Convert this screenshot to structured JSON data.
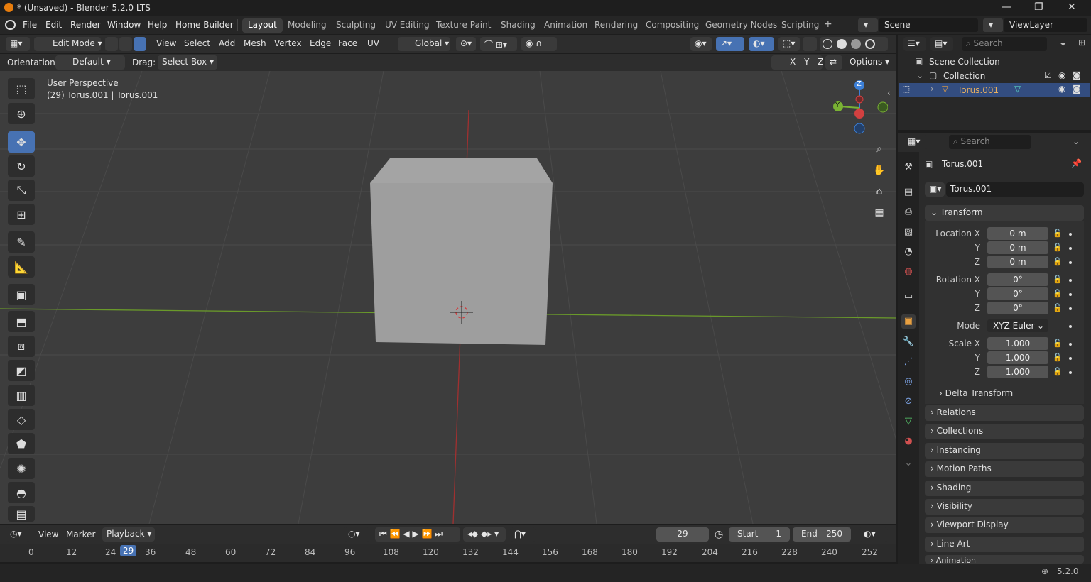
{
  "window": {
    "title": "* (Unsaved) - Blender 5.2.0 LTS",
    "minimize": "—",
    "maximize": "❐",
    "close": "✕"
  },
  "menu": {
    "items": [
      "File",
      "Edit",
      "Render",
      "Window",
      "Help",
      "Home Builder"
    ]
  },
  "workspaces": [
    "Layout",
    "Modeling",
    "Sculpting",
    "UV Editing",
    "Texture Paint",
    "Shading",
    "Animation",
    "Rendering",
    "Compositing",
    "Geometry Nodes",
    "Scripting",
    "+"
  ],
  "scene": {
    "label": "Scene",
    "viewlayer": "ViewLayer"
  },
  "viewport_header": {
    "mode": "Edit Mode",
    "menus": [
      "View",
      "Select",
      "Add",
      "Mesh",
      "Vertex",
      "Edge",
      "Face",
      "UV"
    ],
    "transform_orientation": "Global"
  },
  "tool_settings": {
    "orientation_label": "Orientation:",
    "orientation_value": "Default",
    "drag_label": "Drag:",
    "drag_value": "Select Box",
    "axes": [
      "X",
      "Y",
      "Z"
    ],
    "options": "Options"
  },
  "viewport": {
    "perspective": "User Perspective",
    "object_info": "(29) Torus.001 | Torus.001"
  },
  "gizmo": {
    "z": "Z",
    "y": "Y"
  },
  "outliner": {
    "search_placeholder": "Search",
    "root": "Scene Collection",
    "collection": "Collection",
    "object": "Torus.001"
  },
  "properties": {
    "search_placeholder": "Search",
    "object_name": "Torus.001",
    "datablock": "Torus.001",
    "transform": {
      "title": "Transform",
      "location_label": "Location X",
      "rotation_label": "Rotation X",
      "scale_label": "Scale X",
      "y": "Y",
      "z": "Z",
      "loc": [
        "0 m",
        "0 m",
        "0 m"
      ],
      "rot": [
        "0°",
        "0°",
        "0°"
      ],
      "scale": [
        "1.000",
        "1.000",
        "1.000"
      ],
      "mode_label": "Mode",
      "mode": "XYZ Euler"
    },
    "delta": "Delta Transform",
    "panels": [
      "Relations",
      "Collections",
      "Instancing",
      "Motion Paths",
      "Shading",
      "Visibility",
      "Viewport Display",
      "Line Art",
      "Animation"
    ]
  },
  "timeline": {
    "menus": [
      "View",
      "Marker"
    ],
    "playback": "Playback",
    "current_frame": "29",
    "start_label": "Start",
    "start": "1",
    "end_label": "End",
    "end": "250",
    "ticks": [
      "0",
      "12",
      "24",
      "29",
      "36",
      "48",
      "60",
      "72",
      "84",
      "96",
      "108",
      "120",
      "132",
      "144",
      "156",
      "168",
      "180",
      "192",
      "204",
      "216",
      "228",
      "240",
      "252"
    ]
  },
  "status": {
    "version": "5.2.0"
  }
}
